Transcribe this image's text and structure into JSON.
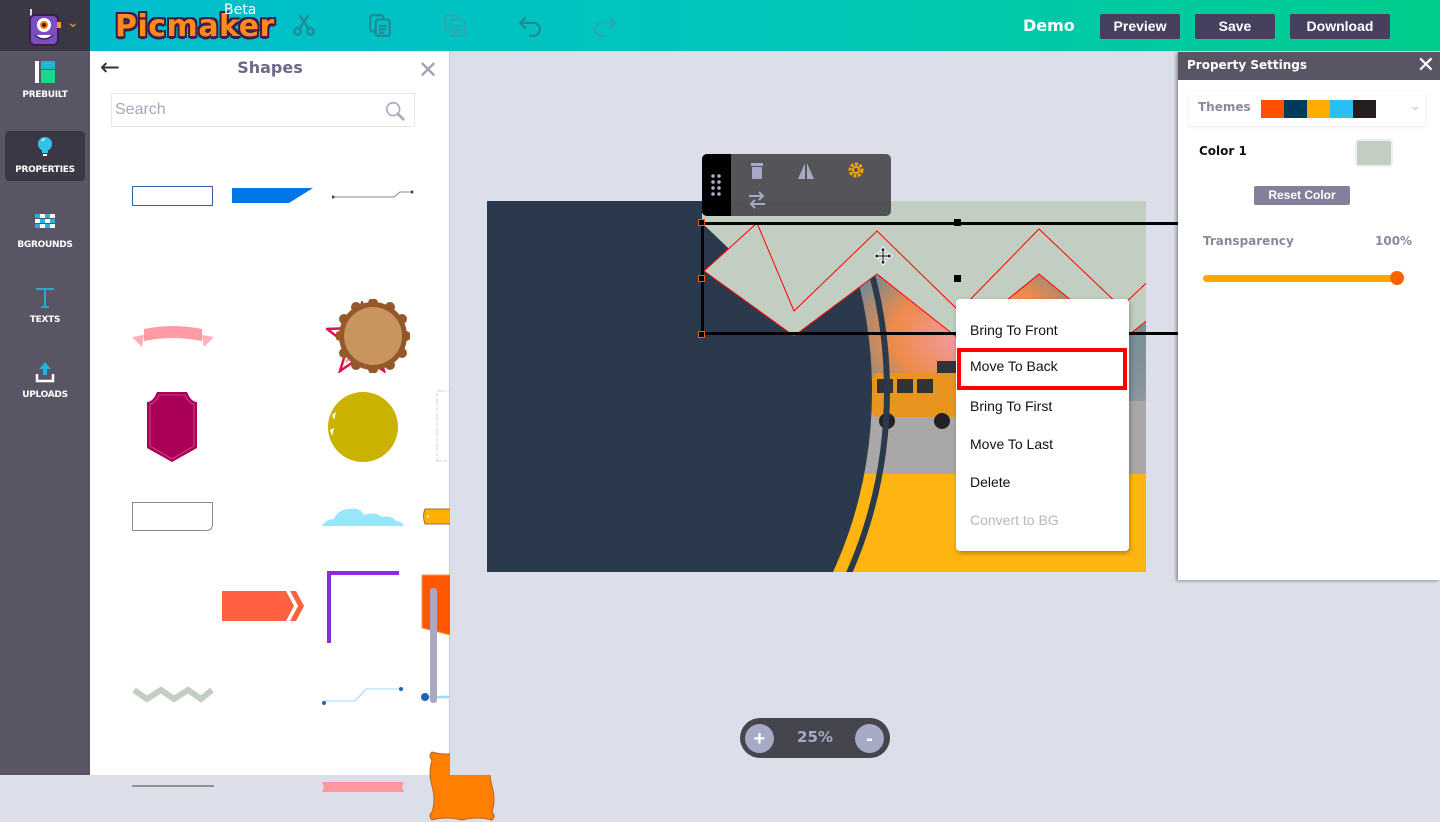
{
  "app": {
    "name": "Picmaker",
    "badge": "Beta",
    "project_name": "Demo"
  },
  "toolbar": {
    "icons": [
      "cut-icon",
      "copy-icon",
      "paste-icon",
      "undo-icon",
      "redo-icon"
    ],
    "preview_label": "Preview",
    "save_label": "Save",
    "download_label": "Download"
  },
  "sidebar": {
    "items": [
      {
        "label": "PREBUILT",
        "icon": "prebuilt-icon",
        "active": false
      },
      {
        "label": "PROPERTIES",
        "icon": "lightbulb-icon",
        "active": true
      },
      {
        "label": "BGROUNDS",
        "icon": "backgrounds-icon",
        "active": false
      },
      {
        "label": "TEXTS",
        "icon": "text-icon",
        "active": false
      },
      {
        "label": "UPLOADS",
        "icon": "upload-icon",
        "active": false
      }
    ]
  },
  "shapes_panel": {
    "title": "Shapes",
    "search_placeholder": "Search",
    "shapes": [
      "rectangle-outline",
      "blue-slanted-banner",
      "connector-line",
      "pink-ribbon",
      "red-star-outline",
      "brown-scalloped-circle",
      "magenta-badge",
      "mustard-brush-circle",
      "dashed-rectangle",
      "folded-corner-box",
      "blue-cloud",
      "orange-plaque",
      "red-arrow-banner",
      "purple-corner-bracket",
      "orange-pentagon-tag",
      "sage-zigzag",
      "blue-step-connector",
      "blue-dot-line",
      "gray-thin-line",
      "pink-tape",
      "orange-ornate-frame"
    ]
  },
  "float_toolbar": {
    "icons": [
      "drag-handle-icon",
      "trash-icon",
      "flip-icon",
      "gear-icon",
      "swap-icon"
    ]
  },
  "context_menu": {
    "items": [
      {
        "label": "Bring To Front",
        "state": "normal"
      },
      {
        "label": "Move To Back",
        "state": "highlighted"
      },
      {
        "label": "Bring To First",
        "state": "normal"
      },
      {
        "label": "Move To Last",
        "state": "normal"
      },
      {
        "label": "Delete",
        "state": "normal"
      },
      {
        "label": "Convert to BG",
        "state": "disabled"
      }
    ]
  },
  "zoom": {
    "value": "25%",
    "plus_label": "+",
    "minus_label": "-"
  },
  "property_settings": {
    "title": "Property Settings",
    "themes_label": "Themes",
    "theme_colors": [
      "#ff5000",
      "#003a5c",
      "#ffab00",
      "#2abff0",
      "#231f20"
    ],
    "color_label": "Color  1",
    "color_value": "#c2cec2",
    "reset_label": "Reset Color",
    "transparency_label": "Transparency",
    "transparency_value": "100%",
    "transparency_fraction": 1.0
  },
  "colors": {
    "artboard_dark": "#2a3a4c",
    "artboard_yellow": "#ffb511",
    "zigzag_fill": "#c2cec2",
    "selection_highlight": "#ff0000"
  }
}
